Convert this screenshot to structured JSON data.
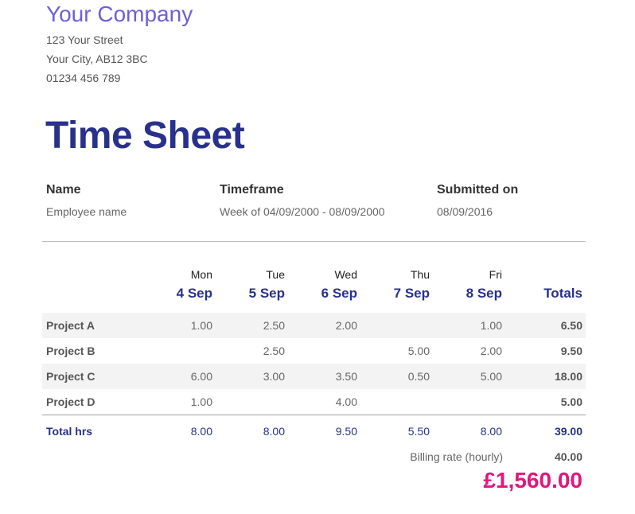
{
  "company": {
    "name": "Your Company",
    "address_line1": "123 Your Street",
    "address_line2": "Your City, AB12 3BC",
    "phone": "01234 456 789"
  },
  "title": "Time Sheet",
  "meta": {
    "name_label": "Name",
    "name_value": "Employee name",
    "timeframe_label": "Timeframe",
    "timeframe_value": "Week of 04/09/2000 - 08/09/2000",
    "submitted_label": "Submitted on",
    "submitted_value": "08/09/2016"
  },
  "columns": [
    {
      "day": "Mon",
      "date": "4 Sep"
    },
    {
      "day": "Tue",
      "date": "5 Sep"
    },
    {
      "day": "Wed",
      "date": "6 Sep"
    },
    {
      "day": "Thu",
      "date": "7 Sep"
    },
    {
      "day": "Fri",
      "date": "8 Sep"
    }
  ],
  "totals_header": "Totals",
  "rows": [
    {
      "project": "Project A",
      "hours": [
        "1.00",
        "2.50",
        "2.00",
        "",
        "1.00"
      ],
      "total": "6.50"
    },
    {
      "project": "Project B",
      "hours": [
        "",
        "2.50",
        "",
        "5.00",
        "2.00"
      ],
      "total": "9.50"
    },
    {
      "project": "Project C",
      "hours": [
        "6.00",
        "3.00",
        "3.50",
        "0.50",
        "5.00"
      ],
      "total": "18.00"
    },
    {
      "project": "Project D",
      "hours": [
        "1.00",
        "",
        "4.00",
        "",
        ""
      ],
      "total": "5.00"
    }
  ],
  "totals": {
    "label": "Total hrs",
    "hours": [
      "8.00",
      "8.00",
      "9.50",
      "5.50",
      "8.00"
    ],
    "total": "39.00"
  },
  "billing": {
    "label": "Billing rate (hourly)",
    "rate": "40.00",
    "amount": "£1,560.00"
  }
}
